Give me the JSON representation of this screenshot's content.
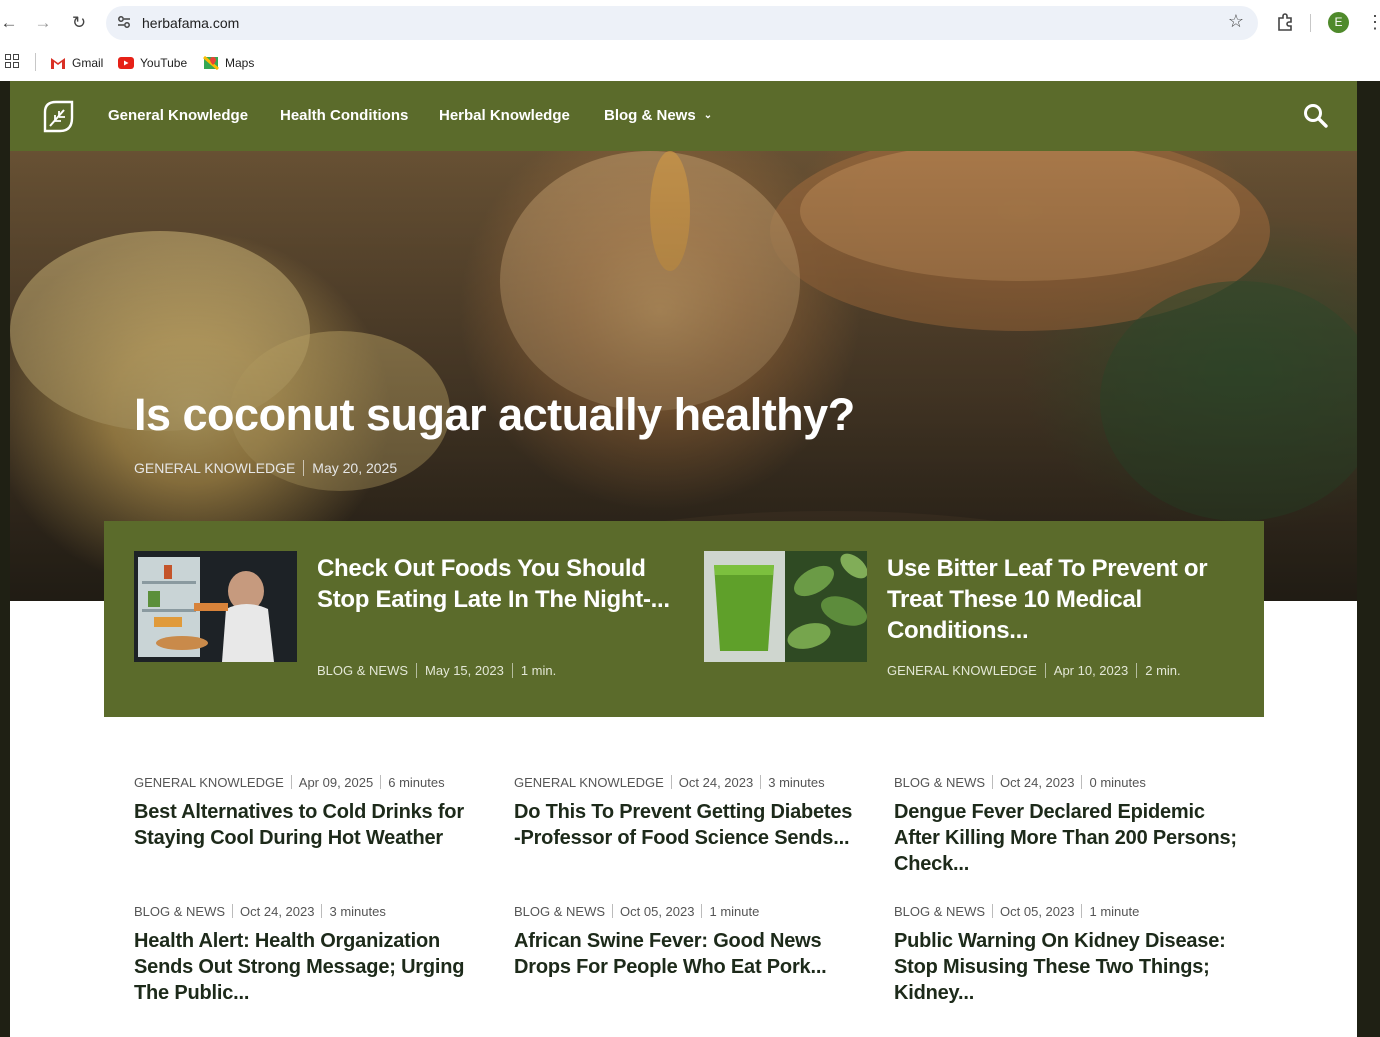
{
  "browser": {
    "url": "herbafama.com",
    "profile_initial": "E",
    "bookmarks": [
      "Gmail",
      "YouTube",
      "Maps"
    ]
  },
  "site": {
    "nav": [
      "General Knowledge",
      "Health Conditions",
      "Herbal Knowledge",
      "Blog & News"
    ],
    "accent_color": "#5b6b2b"
  },
  "hero": {
    "title": "Is coconut sugar actually healthy?",
    "category": "GENERAL KNOWLEDGE",
    "date": "May 20, 2025"
  },
  "featured": [
    {
      "title": "Check Out Foods You Should Stop Eating Late In The Night-...",
      "category": "BLOG & NEWS",
      "date": "May 15, 2023",
      "read": "1 min."
    },
    {
      "title": "Use Bitter Leaf To Prevent or Treat These 10 Medical Conditions...",
      "category": "GENERAL KNOWLEDGE",
      "date": "Apr 10, 2023",
      "read": "2 min."
    }
  ],
  "articles": [
    {
      "category": "GENERAL KNOWLEDGE",
      "date": "Apr 09, 2025",
      "read": "6 minutes",
      "title": "Best Alternatives to Cold Drinks for Staying Cool During Hot Weather"
    },
    {
      "category": "GENERAL KNOWLEDGE",
      "date": "Oct 24, 2023",
      "read": "3 minutes",
      "title": "Do This To Prevent Getting Diabetes -Professor of Food Science Sends..."
    },
    {
      "category": "BLOG & NEWS",
      "date": "Oct 24, 2023",
      "read": "0 minutes",
      "title": "Dengue Fever Declared Epidemic After Killing More Than 200 Persons; Check..."
    },
    {
      "category": "BLOG & NEWS",
      "date": "Oct 24, 2023",
      "read": "3 minutes",
      "title": "Health Alert: Health Organization Sends Out Strong Message; Urging The Public..."
    },
    {
      "category": "BLOG & NEWS",
      "date": "Oct 05, 2023",
      "read": "1 minute",
      "title": "African Swine Fever: Good News Drops For People Who Eat Pork..."
    },
    {
      "category": "BLOG & NEWS",
      "date": "Oct 05, 2023",
      "read": "1 minute",
      "title": "Public Warning On Kidney Disease: Stop Misusing These Two Things; Kidney..."
    }
  ]
}
